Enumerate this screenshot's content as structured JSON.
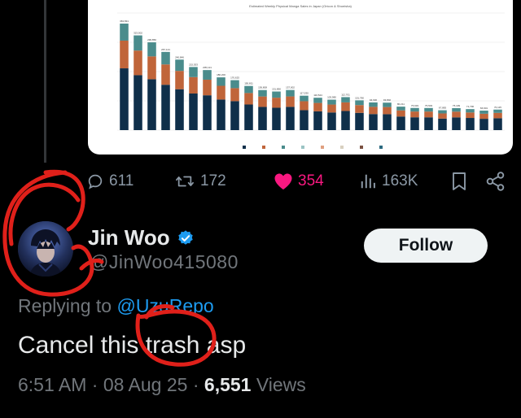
{
  "embedded_chart": {
    "title": "Estimated Weekly Physical Manga Sales in Japan (Oricon & Shoeisha)",
    "value_labels": [
      "363,831",
      "323,502",
      "299,850",
      "267,121",
      "240,846",
      "215,553",
      "205,121",
      "180,200",
      "170,625",
      "150,811",
      "136,808",
      "131,890",
      "137,002",
      "117,530",
      "110,524",
      "103,980",
      "112,701",
      "101,780",
      "94,630",
      "93,802",
      "80,211",
      "75,633",
      "75,503",
      "67,883",
      "75,109",
      "71,700",
      "66,601",
      "70,115"
    ],
    "bar_color_top": "#4a8c8c",
    "bar_color_main": "#0f2f4a",
    "bar_color_mid": "#c0653a"
  },
  "tweet_actions": {
    "reply_count": "611",
    "repost_count": "172",
    "like_count": "354",
    "views_count": "163K"
  },
  "reply": {
    "display_name": "Jin Woo",
    "handle": "@JinWoo415080",
    "follow_label": "Follow",
    "replying_prefix": "Replying to",
    "replying_to": "@UzuRepo",
    "text": "Cancel this trash asp",
    "time": "6:51 AM",
    "date": "08 Aug 25",
    "views_number": "6,551",
    "views_label": "Views"
  },
  "colors": {
    "like_pink": "#f91880",
    "verified_blue": "#1d9bf0",
    "scribble_red": "#e0201a"
  },
  "icons": [
    "reply-icon",
    "repost-icon",
    "heart-icon",
    "views-icon",
    "bookmark-icon",
    "share-icon",
    "verified-badge-icon"
  ]
}
